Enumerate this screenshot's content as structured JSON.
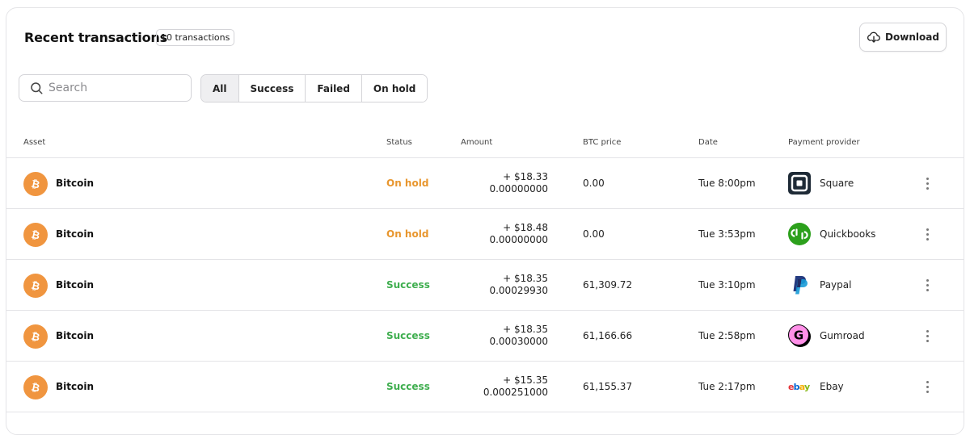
{
  "header": {
    "title": "Recent transactions",
    "count_badge": "10 transactions",
    "download_label": "Download"
  },
  "search": {
    "placeholder": "Search",
    "value": ""
  },
  "filters": [
    {
      "label": "All",
      "active": true
    },
    {
      "label": "Success",
      "active": false
    },
    {
      "label": "Failed",
      "active": false
    },
    {
      "label": "On hold",
      "active": false
    }
  ],
  "table": {
    "columns": [
      "Asset",
      "Status",
      "Amount",
      "BTC price",
      "Date",
      "Payment provider"
    ],
    "rows": [
      {
        "asset": "Bitcoin",
        "status": "On hold",
        "amount_usd": "+ $18.33",
        "amount_btc": "0.00000000",
        "btc_price": "0.00",
        "date": "Tue 8:00pm",
        "provider": "Square",
        "provider_icon": "square-logo-icon"
      },
      {
        "asset": "Bitcoin",
        "status": "On hold",
        "amount_usd": "+ $18.48",
        "amount_btc": "0.00000000",
        "btc_price": "0.00",
        "date": "Tue 3:53pm",
        "provider": "Quickbooks",
        "provider_icon": "quickbooks-logo-icon"
      },
      {
        "asset": "Bitcoin",
        "status": "Success",
        "amount_usd": "+ $18.35",
        "amount_btc": "0.00029930",
        "btc_price": "61,309.72",
        "date": "Tue 3:10pm",
        "provider": "Paypal",
        "provider_icon": "paypal-logo-icon"
      },
      {
        "asset": "Bitcoin",
        "status": "Success",
        "amount_usd": "+ $18.35",
        "amount_btc": "0.00030000",
        "btc_price": "61,166.66",
        "date": "Tue 2:58pm",
        "provider": "Gumroad",
        "provider_icon": "gumroad-logo-icon"
      },
      {
        "asset": "Bitcoin",
        "status": "Success",
        "amount_usd": "+ $15.35",
        "amount_btc": "0.000251000",
        "btc_price": "61,155.37",
        "date": "Tue 2:17pm",
        "provider": "Ebay",
        "provider_icon": "ebay-logo-icon"
      }
    ]
  },
  "colors": {
    "on_hold": "#e8962e",
    "success": "#3fae4f",
    "bitcoin": "#f0953f"
  }
}
